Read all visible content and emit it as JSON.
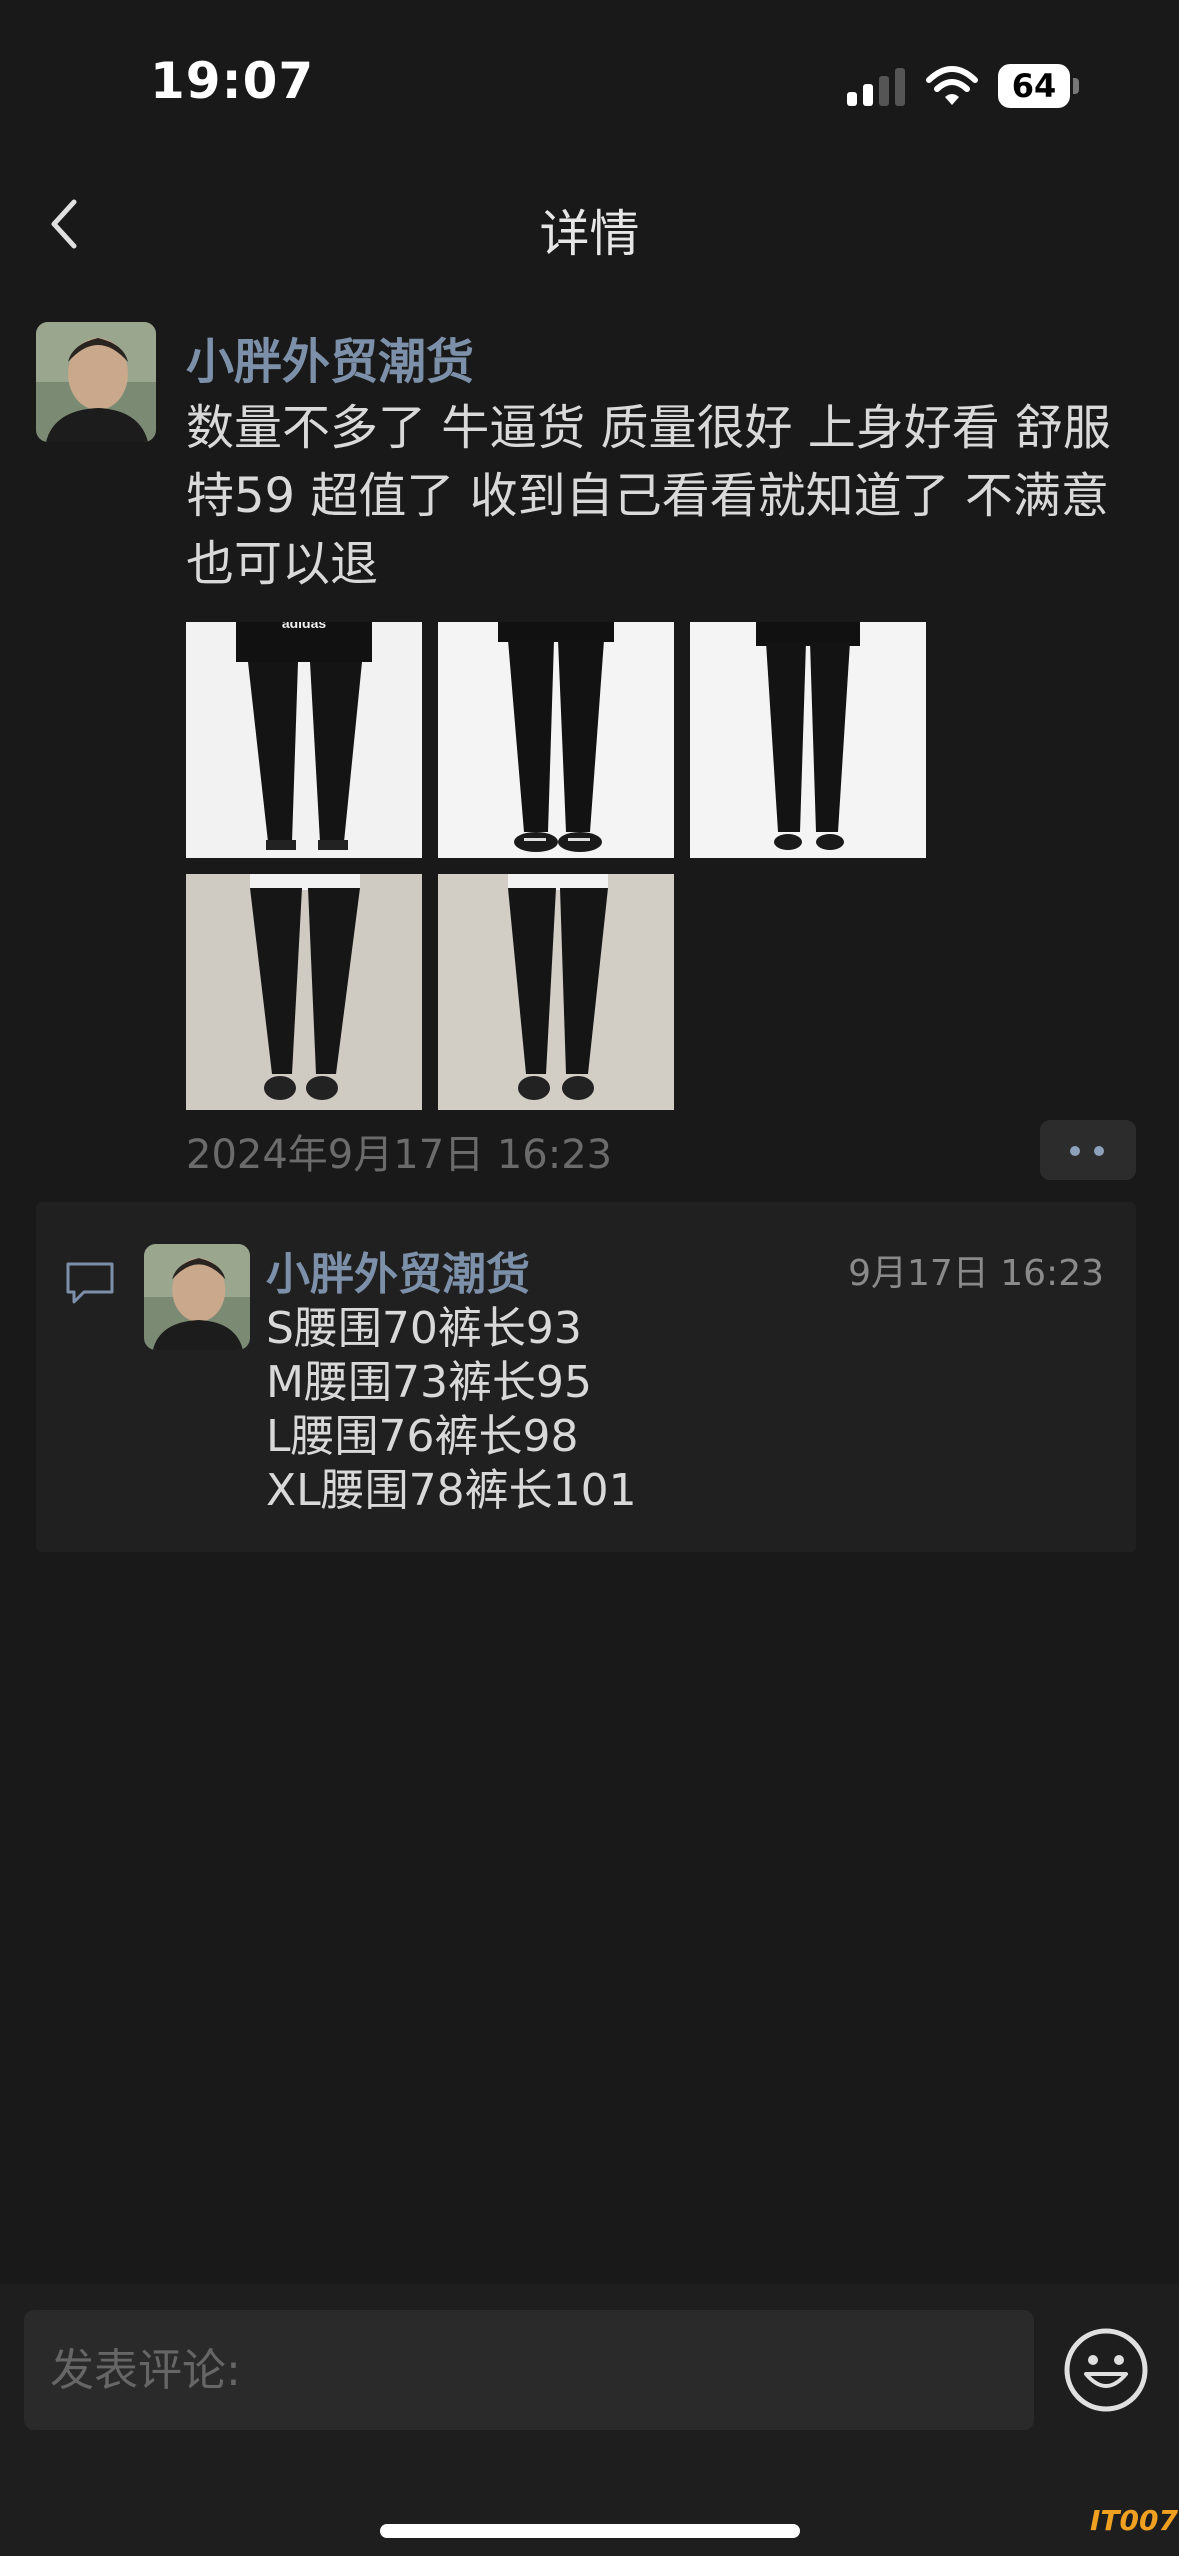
{
  "status_bar": {
    "time": "19:07",
    "battery": "64"
  },
  "nav": {
    "title": "详情"
  },
  "post": {
    "author": "小胖外贸潮货",
    "text": "数量不多了 牛逼货  质量很好  上身好看 舒服  特59  超值了   收到自己看看就知道了 不满意也可以退",
    "images": [
      {
        "name": "pants-photo-1",
        "brand_text": "adidas"
      },
      {
        "name": "pants-photo-2"
      },
      {
        "name": "pants-photo-3"
      },
      {
        "name": "pants-photo-4"
      },
      {
        "name": "pants-photo-5"
      }
    ],
    "time": "2024年9月17日 16:23"
  },
  "comments": [
    {
      "author": "小胖外贸潮货",
      "time": "9月17日 16:23",
      "lines": [
        "S腰围70裤长93",
        "M腰围73裤长95",
        "L腰围76裤长98",
        "XL腰围78裤长101"
      ]
    }
  ],
  "input": {
    "placeholder": "发表评论:"
  },
  "watermark": "IT007",
  "colors": {
    "background": "#191919",
    "author": "#7d90a9",
    "accent_dots": "#8ea1bb"
  }
}
